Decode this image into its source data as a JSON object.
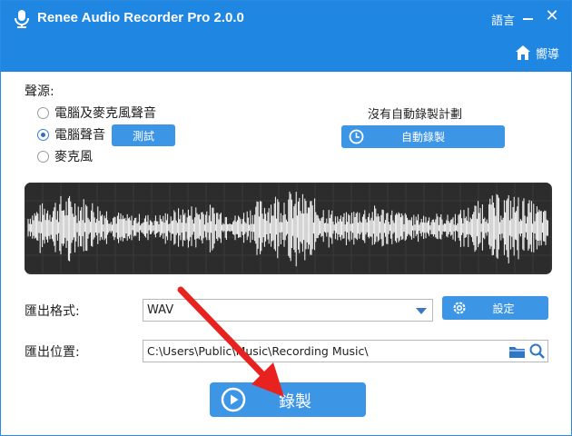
{
  "window": {
    "title": "Renee Audio Recorder Pro 2.0.0",
    "language_label": "語言",
    "close_symbol": "✕",
    "nav_label": "嚮導"
  },
  "source": {
    "label": "聲源:",
    "options": [
      {
        "label": "電腦及麥克風聲音",
        "selected": false
      },
      {
        "label": "電腦聲音",
        "selected": true
      },
      {
        "label": "麥克風",
        "selected": false
      }
    ],
    "test_button": "測試"
  },
  "schedule": {
    "status_text": "沒有自動錄製計劃",
    "button_label": "自動錄製"
  },
  "output": {
    "format_label": "匯出格式:",
    "format_value": "WAV",
    "settings_button": "設定",
    "location_label": "匯出位置:",
    "location_value": "C:\\Users\\Public\\Music\\Recording Music\\"
  },
  "record_button": "錄製",
  "icons": [
    "app-mic-icon",
    "home-icon",
    "clock-icon",
    "chevron-down-icon",
    "gear-icon",
    "folder-icon",
    "search-icon",
    "play-icon",
    "red-arrow-annotation"
  ],
  "colors": {
    "accent": "#1f86e2",
    "button": "#3d95e6",
    "waveform_bg": "#2c2c2c",
    "annotation": "#e8231f"
  }
}
